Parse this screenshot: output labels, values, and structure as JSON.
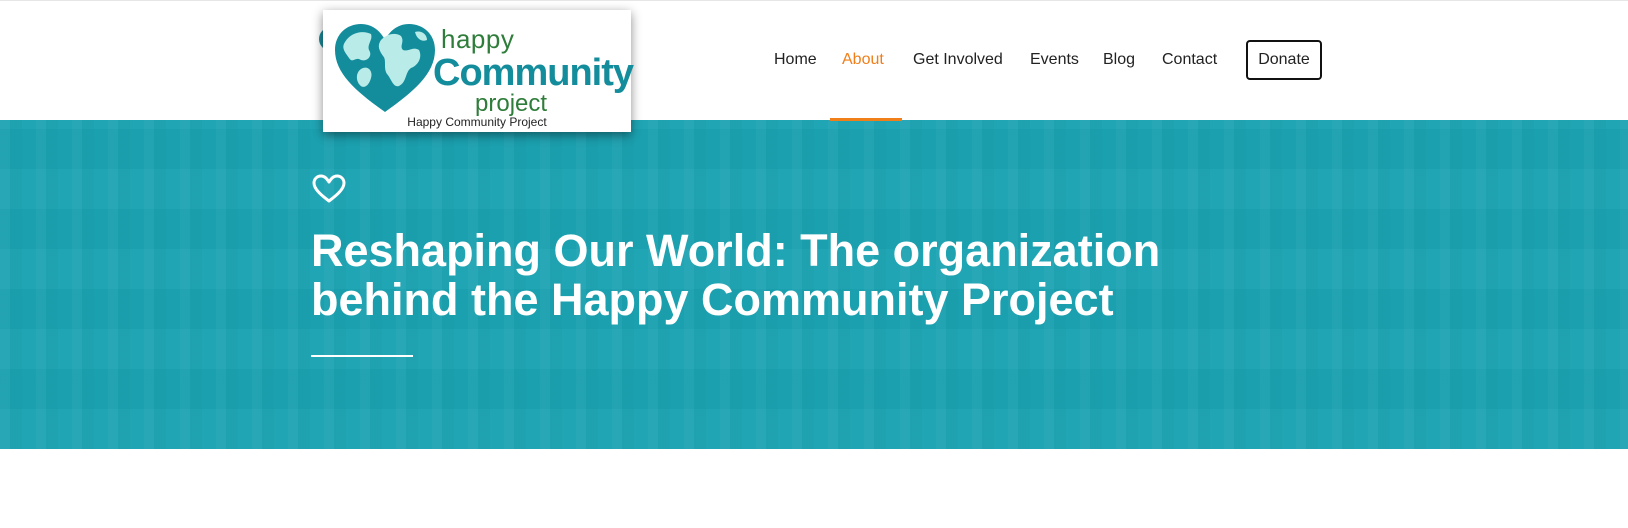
{
  "logo": {
    "word_happy": "happy",
    "word_community": "Community",
    "word_project": "project",
    "caption": "Happy Community Project",
    "icon": "heart-globe-icon",
    "colors": {
      "teal": "#138c9c",
      "green": "#2e7d3a",
      "globe_light": "#b9ece8"
    }
  },
  "nav": {
    "items": [
      {
        "label": "Home",
        "active": false
      },
      {
        "label": "About",
        "active": true
      },
      {
        "label": "Get Involved",
        "active": false
      },
      {
        "label": "Events",
        "active": false
      },
      {
        "label": "Blog",
        "active": false
      },
      {
        "label": "Contact",
        "active": false
      }
    ],
    "donate_label": "Donate",
    "active_color": "#f07f1a"
  },
  "hero": {
    "icon": "heart-outline-icon",
    "title": "Reshaping Our World: The organization behind the Happy Community Project",
    "background_color": "#1ba3b2"
  }
}
